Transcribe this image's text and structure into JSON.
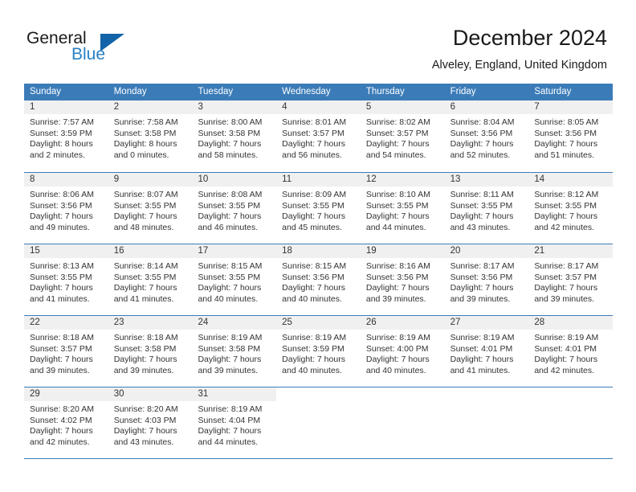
{
  "brand": {
    "name_part1": "General",
    "name_part2": "Blue",
    "triangle_color": "#1263a8",
    "blue_text_color": "#2980c4"
  },
  "header": {
    "title": "December 2024",
    "subtitle": "Alveley, England, United Kingdom"
  },
  "theme": {
    "header_blue": "#3b7cb8",
    "day_band_gray": "#f0f0f0",
    "text_color": "#333333"
  },
  "weekdays": [
    "Sunday",
    "Monday",
    "Tuesday",
    "Wednesday",
    "Thursday",
    "Friday",
    "Saturday"
  ],
  "weeks": [
    [
      {
        "day": "1",
        "sunrise": "Sunrise: 7:57 AM",
        "sunset": "Sunset: 3:59 PM",
        "daylight_line1": "Daylight: 8 hours",
        "daylight_line2": "and 2 minutes."
      },
      {
        "day": "2",
        "sunrise": "Sunrise: 7:58 AM",
        "sunset": "Sunset: 3:58 PM",
        "daylight_line1": "Daylight: 8 hours",
        "daylight_line2": "and 0 minutes."
      },
      {
        "day": "3",
        "sunrise": "Sunrise: 8:00 AM",
        "sunset": "Sunset: 3:58 PM",
        "daylight_line1": "Daylight: 7 hours",
        "daylight_line2": "and 58 minutes."
      },
      {
        "day": "4",
        "sunrise": "Sunrise: 8:01 AM",
        "sunset": "Sunset: 3:57 PM",
        "daylight_line1": "Daylight: 7 hours",
        "daylight_line2": "and 56 minutes."
      },
      {
        "day": "5",
        "sunrise": "Sunrise: 8:02 AM",
        "sunset": "Sunset: 3:57 PM",
        "daylight_line1": "Daylight: 7 hours",
        "daylight_line2": "and 54 minutes."
      },
      {
        "day": "6",
        "sunrise": "Sunrise: 8:04 AM",
        "sunset": "Sunset: 3:56 PM",
        "daylight_line1": "Daylight: 7 hours",
        "daylight_line2": "and 52 minutes."
      },
      {
        "day": "7",
        "sunrise": "Sunrise: 8:05 AM",
        "sunset": "Sunset: 3:56 PM",
        "daylight_line1": "Daylight: 7 hours",
        "daylight_line2": "and 51 minutes."
      }
    ],
    [
      {
        "day": "8",
        "sunrise": "Sunrise: 8:06 AM",
        "sunset": "Sunset: 3:56 PM",
        "daylight_line1": "Daylight: 7 hours",
        "daylight_line2": "and 49 minutes."
      },
      {
        "day": "9",
        "sunrise": "Sunrise: 8:07 AM",
        "sunset": "Sunset: 3:55 PM",
        "daylight_line1": "Daylight: 7 hours",
        "daylight_line2": "and 48 minutes."
      },
      {
        "day": "10",
        "sunrise": "Sunrise: 8:08 AM",
        "sunset": "Sunset: 3:55 PM",
        "daylight_line1": "Daylight: 7 hours",
        "daylight_line2": "and 46 minutes."
      },
      {
        "day": "11",
        "sunrise": "Sunrise: 8:09 AM",
        "sunset": "Sunset: 3:55 PM",
        "daylight_line1": "Daylight: 7 hours",
        "daylight_line2": "and 45 minutes."
      },
      {
        "day": "12",
        "sunrise": "Sunrise: 8:10 AM",
        "sunset": "Sunset: 3:55 PM",
        "daylight_line1": "Daylight: 7 hours",
        "daylight_line2": "and 44 minutes."
      },
      {
        "day": "13",
        "sunrise": "Sunrise: 8:11 AM",
        "sunset": "Sunset: 3:55 PM",
        "daylight_line1": "Daylight: 7 hours",
        "daylight_line2": "and 43 minutes."
      },
      {
        "day": "14",
        "sunrise": "Sunrise: 8:12 AM",
        "sunset": "Sunset: 3:55 PM",
        "daylight_line1": "Daylight: 7 hours",
        "daylight_line2": "and 42 minutes."
      }
    ],
    [
      {
        "day": "15",
        "sunrise": "Sunrise: 8:13 AM",
        "sunset": "Sunset: 3:55 PM",
        "daylight_line1": "Daylight: 7 hours",
        "daylight_line2": "and 41 minutes."
      },
      {
        "day": "16",
        "sunrise": "Sunrise: 8:14 AM",
        "sunset": "Sunset: 3:55 PM",
        "daylight_line1": "Daylight: 7 hours",
        "daylight_line2": "and 41 minutes."
      },
      {
        "day": "17",
        "sunrise": "Sunrise: 8:15 AM",
        "sunset": "Sunset: 3:55 PM",
        "daylight_line1": "Daylight: 7 hours",
        "daylight_line2": "and 40 minutes."
      },
      {
        "day": "18",
        "sunrise": "Sunrise: 8:15 AM",
        "sunset": "Sunset: 3:56 PM",
        "daylight_line1": "Daylight: 7 hours",
        "daylight_line2": "and 40 minutes."
      },
      {
        "day": "19",
        "sunrise": "Sunrise: 8:16 AM",
        "sunset": "Sunset: 3:56 PM",
        "daylight_line1": "Daylight: 7 hours",
        "daylight_line2": "and 39 minutes."
      },
      {
        "day": "20",
        "sunrise": "Sunrise: 8:17 AM",
        "sunset": "Sunset: 3:56 PM",
        "daylight_line1": "Daylight: 7 hours",
        "daylight_line2": "and 39 minutes."
      },
      {
        "day": "21",
        "sunrise": "Sunrise: 8:17 AM",
        "sunset": "Sunset: 3:57 PM",
        "daylight_line1": "Daylight: 7 hours",
        "daylight_line2": "and 39 minutes."
      }
    ],
    [
      {
        "day": "22",
        "sunrise": "Sunrise: 8:18 AM",
        "sunset": "Sunset: 3:57 PM",
        "daylight_line1": "Daylight: 7 hours",
        "daylight_line2": "and 39 minutes."
      },
      {
        "day": "23",
        "sunrise": "Sunrise: 8:18 AM",
        "sunset": "Sunset: 3:58 PM",
        "daylight_line1": "Daylight: 7 hours",
        "daylight_line2": "and 39 minutes."
      },
      {
        "day": "24",
        "sunrise": "Sunrise: 8:19 AM",
        "sunset": "Sunset: 3:58 PM",
        "daylight_line1": "Daylight: 7 hours",
        "daylight_line2": "and 39 minutes."
      },
      {
        "day": "25",
        "sunrise": "Sunrise: 8:19 AM",
        "sunset": "Sunset: 3:59 PM",
        "daylight_line1": "Daylight: 7 hours",
        "daylight_line2": "and 40 minutes."
      },
      {
        "day": "26",
        "sunrise": "Sunrise: 8:19 AM",
        "sunset": "Sunset: 4:00 PM",
        "daylight_line1": "Daylight: 7 hours",
        "daylight_line2": "and 40 minutes."
      },
      {
        "day": "27",
        "sunrise": "Sunrise: 8:19 AM",
        "sunset": "Sunset: 4:01 PM",
        "daylight_line1": "Daylight: 7 hours",
        "daylight_line2": "and 41 minutes."
      },
      {
        "day": "28",
        "sunrise": "Sunrise: 8:19 AM",
        "sunset": "Sunset: 4:01 PM",
        "daylight_line1": "Daylight: 7 hours",
        "daylight_line2": "and 42 minutes."
      }
    ],
    [
      {
        "day": "29",
        "sunrise": "Sunrise: 8:20 AM",
        "sunset": "Sunset: 4:02 PM",
        "daylight_line1": "Daylight: 7 hours",
        "daylight_line2": "and 42 minutes."
      },
      {
        "day": "30",
        "sunrise": "Sunrise: 8:20 AM",
        "sunset": "Sunset: 4:03 PM",
        "daylight_line1": "Daylight: 7 hours",
        "daylight_line2": "and 43 minutes."
      },
      {
        "day": "31",
        "sunrise": "Sunrise: 8:19 AM",
        "sunset": "Sunset: 4:04 PM",
        "daylight_line1": "Daylight: 7 hours",
        "daylight_line2": "and 44 minutes."
      },
      {
        "day": "",
        "sunrise": "",
        "sunset": "",
        "daylight_line1": "",
        "daylight_line2": ""
      },
      {
        "day": "",
        "sunrise": "",
        "sunset": "",
        "daylight_line1": "",
        "daylight_line2": ""
      },
      {
        "day": "",
        "sunrise": "",
        "sunset": "",
        "daylight_line1": "",
        "daylight_line2": ""
      },
      {
        "day": "",
        "sunrise": "",
        "sunset": "",
        "daylight_line1": "",
        "daylight_line2": ""
      }
    ]
  ]
}
